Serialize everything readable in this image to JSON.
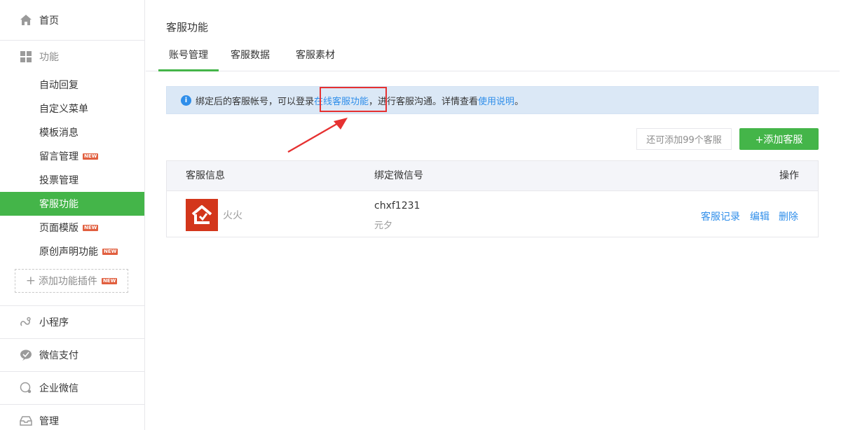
{
  "sidebar": {
    "home": {
      "label": "首页",
      "icon": "home-icon"
    },
    "function_group": {
      "title": "功能",
      "icon": "grid-icon"
    },
    "items": [
      {
        "label": "自动回复",
        "new": false,
        "active": false
      },
      {
        "label": "自定义菜单",
        "new": false,
        "active": false
      },
      {
        "label": "模板消息",
        "new": false,
        "active": false
      },
      {
        "label": "留言管理",
        "new": true,
        "active": false
      },
      {
        "label": "投票管理",
        "new": false,
        "active": false
      },
      {
        "label": "客服功能",
        "new": false,
        "active": true
      },
      {
        "label": "页面模版",
        "new": true,
        "active": false
      },
      {
        "label": "原创声明功能",
        "new": true,
        "active": false
      }
    ],
    "new_badge": "NEW",
    "add_plugin": "添加功能插件",
    "sections": [
      {
        "label": "小程序",
        "icon": "mini-program-icon"
      },
      {
        "label": "微信支付",
        "icon": "wechat-pay-icon"
      },
      {
        "label": "企业微信",
        "icon": "work-wechat-icon"
      },
      {
        "label": "管理",
        "icon": "manage-icon"
      }
    ]
  },
  "main": {
    "title": "客服功能",
    "tabs": [
      {
        "label": "账号管理",
        "active": true
      },
      {
        "label": "客服数据",
        "active": false
      },
      {
        "label": "客服素材",
        "active": false
      }
    ],
    "notice": {
      "prefix": "绑定后的客服帐号，可以登录",
      "link1": "在线客服功能",
      "middle": "，进行客服沟通。详情查看",
      "link2": "使用说明",
      "suffix": "。"
    },
    "quota_text": "还可添加99个客服",
    "add_button": "+添加客服",
    "table": {
      "headers": {
        "info": "客服信息",
        "wechat": "绑定微信号",
        "ops": "操作"
      },
      "rows": [
        {
          "name": "火火",
          "wechat_id": "chxf1231",
          "nickname": "元夕",
          "actions": {
            "records": "客服记录",
            "edit": "编辑",
            "delete": "删除"
          }
        }
      ]
    }
  },
  "colors": {
    "accent": "#44b549",
    "link": "#2f8eea",
    "highlight": "#e63131",
    "badge": "#e15f3f"
  }
}
